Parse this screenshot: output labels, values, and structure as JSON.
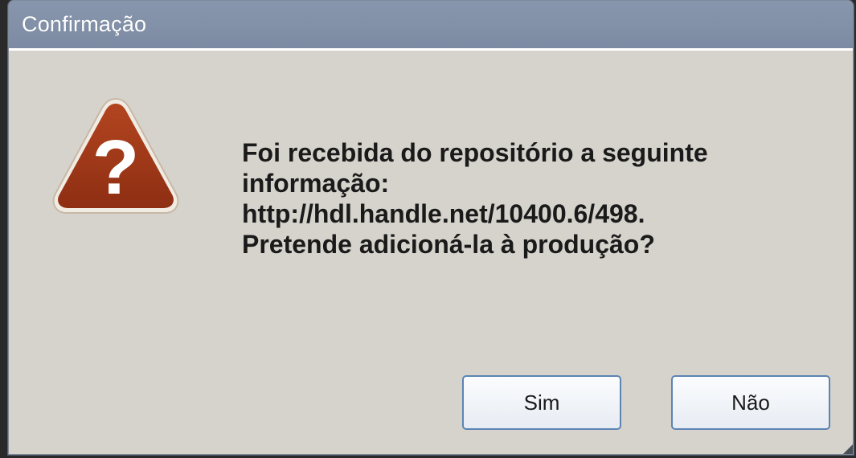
{
  "dialog": {
    "title": "Confirmação",
    "icon": "question-warning-icon",
    "message_lines": [
      "Foi recebida do repositório a seguinte",
      "informação:",
      "http://hdl.handle.net/10400.6/498.",
      "Pretende adicioná-la à produção?"
    ],
    "buttons": {
      "yes_label": "Sim",
      "no_label": "Não"
    }
  },
  "colors": {
    "titlebar": "#7f8da5",
    "body": "#d6d3cc",
    "icon_fill": "#a63a1c",
    "button_border": "#5b84b3"
  }
}
